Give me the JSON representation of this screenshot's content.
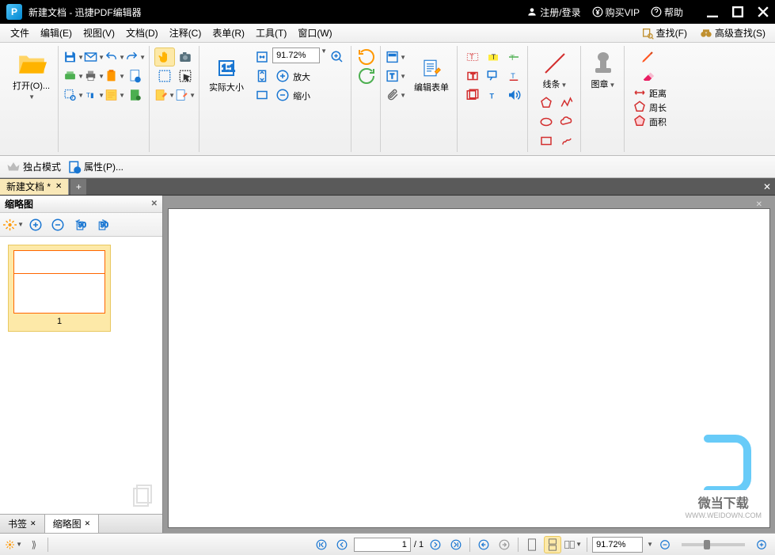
{
  "title": "新建文档 - 迅捷PDF编辑器",
  "titleButtons": {
    "login": "注册/登录",
    "vip": "购买VIP",
    "help": "帮助"
  },
  "menu": {
    "file": "文件",
    "edit": "编辑(E)",
    "view": "视图(V)",
    "document": "文档(D)",
    "comment": "注释(C)",
    "form": "表单(R)",
    "tool": "工具(T)",
    "window": "窗口(W)"
  },
  "menuRight": {
    "find": "查找(F)",
    "advFind": "高级查找(S)"
  },
  "ribbon": {
    "open": "打开(O)...",
    "actualSize": "实际大小",
    "zoomIn": "放大",
    "zoomOut": "缩小",
    "zoomValue": "91.72%",
    "editForm": "编辑表单",
    "lines": "线条",
    "stamp": "图章",
    "distance": "距离",
    "perimeter": "周长",
    "area": "面积"
  },
  "subbar": {
    "exclusive": "独占模式",
    "properties": "属性(P)..."
  },
  "docTab": "新建文档 *",
  "panel": {
    "title": "缩略图",
    "pageNum": "1",
    "tabBookmark": "书签",
    "tabThumbnail": "缩略图"
  },
  "status": {
    "pageCurrent": "1",
    "pageTotal": "/ 1",
    "zoom": "91.72%"
  },
  "watermark": {
    "text": "微当下载",
    "url": "WWW.WEIDOWN.COM"
  }
}
